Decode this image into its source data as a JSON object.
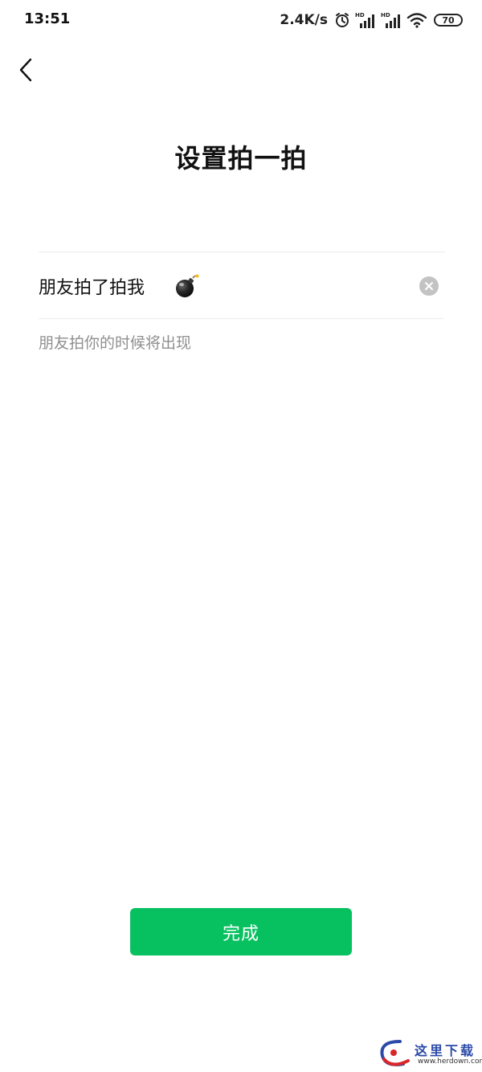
{
  "status_bar": {
    "time": "13:51",
    "net_speed": "2.4K/s",
    "battery_level": "70",
    "icons": [
      "alarm-icon",
      "hd-signal-icon",
      "hd-signal-icon",
      "wifi-icon",
      "battery-icon"
    ]
  },
  "header": {
    "back_icon": "chevron-left-icon",
    "title": "设置拍一拍"
  },
  "pat_setting": {
    "prefix_text": "朋友拍了拍我",
    "suffix_emoji": "bomb-icon",
    "clear_icon": "clear-icon",
    "hint": "朋友拍你的时候将出现"
  },
  "footer": {
    "done_label": "完成"
  },
  "watermark": {
    "text": "这里下载",
    "url": "www.herdown.com"
  },
  "colors": {
    "primary_green": "#07c160",
    "hint_gray": "#8f8f8f",
    "divider": "#ececec",
    "clear_gray": "#c3c3c3",
    "background": "#ffffff"
  }
}
